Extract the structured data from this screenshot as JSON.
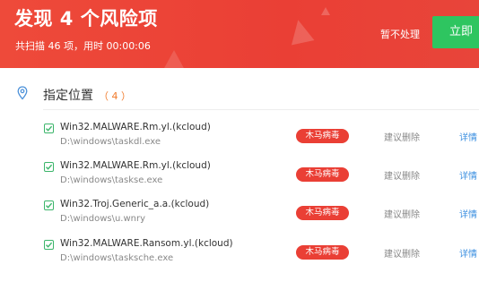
{
  "header": {
    "title": "发现 4 个风险项",
    "subtitle": "共扫描 46 项，用时 00:00:06",
    "ignore_label": "暂不处理",
    "fix_label": "立即"
  },
  "section": {
    "title": "指定位置",
    "count": "（ 4 ）"
  },
  "items": [
    {
      "name": "Win32.MALWARE.Rm.yl.(kcloud)",
      "path": "D:\\windows\\taskdl.exe",
      "type": "木马病毒",
      "suggestion": "建议删除",
      "detail": "详情"
    },
    {
      "name": "Win32.MALWARE.Rm.yl.(kcloud)",
      "path": "D:\\windows\\taskse.exe",
      "type": "木马病毒",
      "suggestion": "建议删除",
      "detail": "详情"
    },
    {
      "name": "Win32.Troj.Generic_a.a.(kcloud)",
      "path": "D:\\windows\\u.wnry",
      "type": "木马病毒",
      "suggestion": "建议删除",
      "detail": "详情"
    },
    {
      "name": "Win32.MALWARE.Ransom.yl.(kcloud)",
      "path": "D:\\windows\\tasksche.exe",
      "type": "木马病毒",
      "suggestion": "建议删除",
      "detail": "详情"
    }
  ],
  "colors": {
    "header_red": "#ea3f35",
    "fix_green": "#2ec560",
    "badge_red": "#ea3f35",
    "count_orange": "#f07a2a",
    "link_blue": "#3b8fe0",
    "check_green": "#3bb56a"
  },
  "icons": {
    "section": "location-pin-icon",
    "row_check": "checkbox-checked-icon"
  }
}
